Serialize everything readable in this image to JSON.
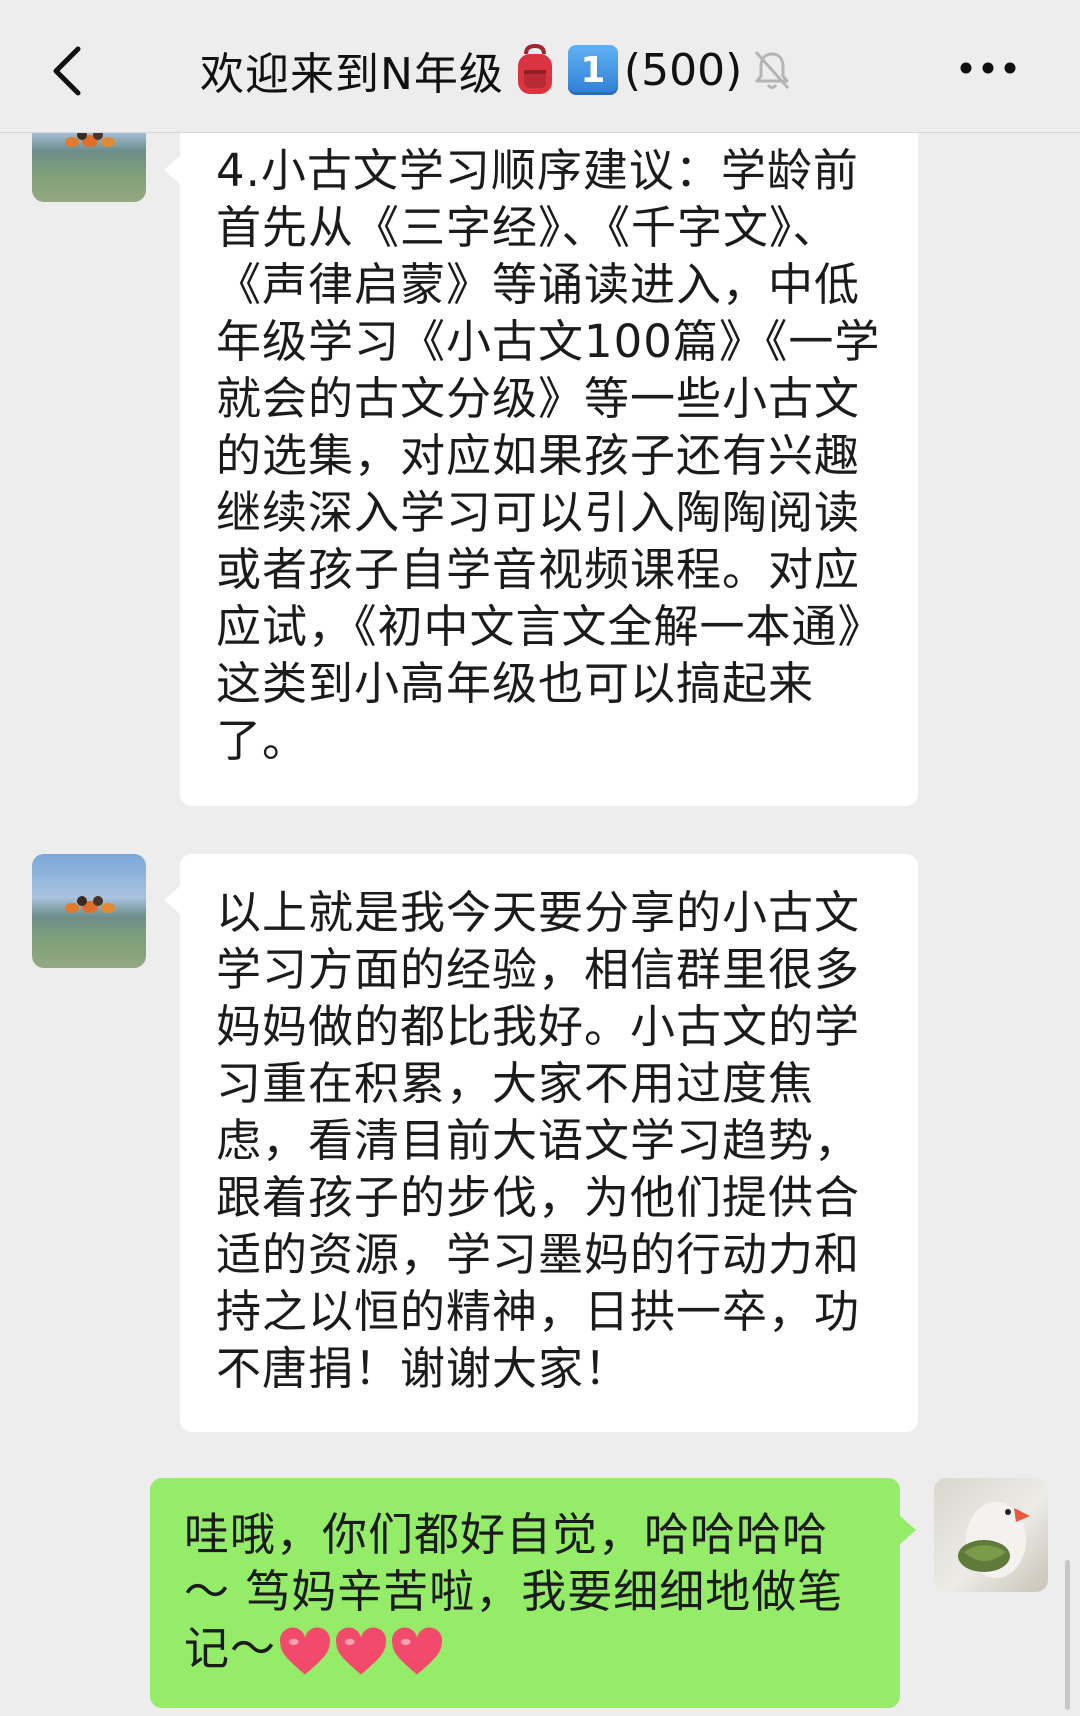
{
  "header": {
    "title": "欢迎来到N年级",
    "badge_number": "1",
    "member_count": "(500)"
  },
  "messages": [
    {
      "sender": "other",
      "text": "4.小古文学习顺序建议：学龄前首先从《三字经》、《千字文》、《声律启蒙》等诵读进入，中低年级学习《小古文100篇》《一学就会的古文分级》等一些小古文的选集，对应如果孩子还有兴趣继续深入学习可以引入陶陶阅读或者孩子自学音视频课程。对应应试，《初中文言文全解一本通》这类到小高年级也可以搞起来了。"
    },
    {
      "sender": "other",
      "text": "以上就是我今天要分享的小古文学习方面的经验，相信群里很多妈妈做的都比我好。小古文的学习重在积累，大家不用过度焦虑，看清目前大语文学习趋势，跟着孩子的步伐，为他们提供合适的资源，学习墨妈的行动力和持之以恒的精神，日拱一卒，功不唐捐！谢谢大家！"
    },
    {
      "sender": "me",
      "text": "哇哦，你们都好自觉，哈哈哈哈～ 笃妈辛苦啦，我要细细地做笔记～"
    }
  ],
  "icons": {
    "back": "chevron-left-icon",
    "mute": "bell-slash-icon",
    "more": "more-dots-icon",
    "backpack": "backpack-emoji",
    "heart": "heart-emoji"
  },
  "colors": {
    "background": "#ededed",
    "bubble_other": "#ffffff",
    "bubble_me": "#95ec69",
    "heart": "#f24a6a"
  }
}
